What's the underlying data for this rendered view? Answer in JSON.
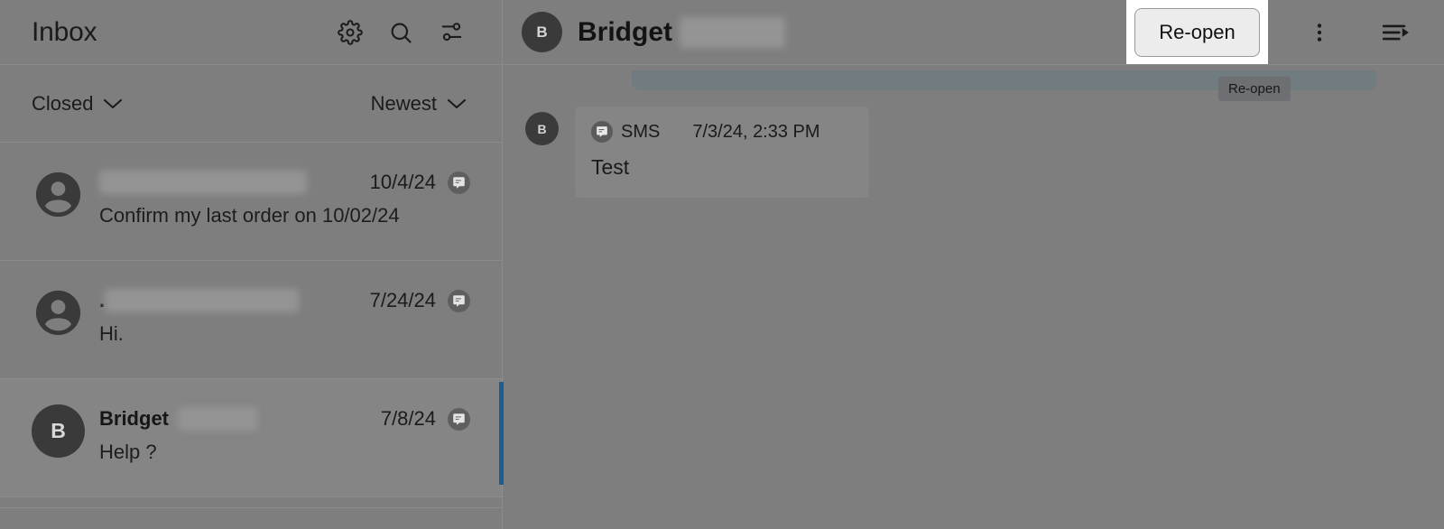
{
  "inbox": {
    "title": "Inbox",
    "header_icons": [
      {
        "name": "settings-gear-icon",
        "label": "Settings"
      },
      {
        "name": "search-icon",
        "label": "Search"
      },
      {
        "name": "filter-tune-icon",
        "label": "Filters"
      }
    ],
    "filters": {
      "status": "Closed",
      "sort": "Newest"
    },
    "conversations": [
      {
        "initial": "",
        "name": "",
        "name_redacted": true,
        "redact_width": 230,
        "date": "10/4/24",
        "preview": "Confirm my last order on 10/02/24",
        "channel_icon": "sms-chat-icon",
        "selected": false
      },
      {
        "initial": "",
        "name": ".",
        "name_redacted": true,
        "redact_width": 215,
        "date": "7/24/24",
        "preview": "Hi.",
        "channel_icon": "sms-chat-icon",
        "selected": false
      },
      {
        "initial": "B",
        "name": "Bridget",
        "name_redacted": true,
        "redact_width": 88,
        "date": "7/8/24",
        "preview": "Help ?",
        "channel_icon": "sms-chat-icon",
        "selected": true
      }
    ]
  },
  "thread": {
    "avatar_initial": "B",
    "contact_name": "Bridget",
    "contact_name_redacted": true,
    "redact_width": 117,
    "reopen_button": "Re-open",
    "reopen_tooltip": "Re-open",
    "actions": [
      {
        "name": "more-vert-icon",
        "label": "More options"
      },
      {
        "name": "thread-details-icon",
        "label": "Details"
      }
    ],
    "messages": [
      {
        "avatar_initial": "B",
        "channel": "SMS",
        "channel_icon": "sms-chat-icon",
        "timestamp": "7/3/24, 2:33 PM",
        "text": "Test"
      }
    ]
  },
  "colors": {
    "overlay_background": "#7e7e7e",
    "selected_indicator": "#1b5e8f",
    "highlight_box": "#ffffff",
    "button_face": "#ececec",
    "avatar_dark": "#3a3a3a",
    "outgoing_bubble": "#707c80",
    "tooltip_background": "#6d6f72"
  }
}
